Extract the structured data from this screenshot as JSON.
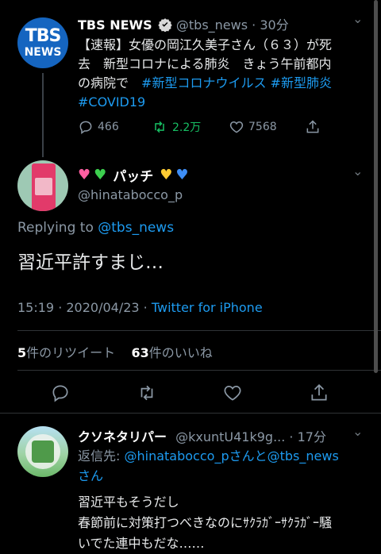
{
  "tweet1": {
    "name": "TBS NEWS",
    "handle": "@tbs_news",
    "time": "30分",
    "text_line1": "【速報】女優の岡江久美子さん（６３）が死",
    "text_line2": "去　新型コロナによる肺炎　きょう午前都内",
    "text_line3": "の病院で",
    "hashtag1": "#新型コロナウイルス",
    "hashtag2": "#新型肺炎",
    "hashtag3": "#COVID19",
    "replies": "466",
    "retweets": "2.2万",
    "likes": "7568",
    "avatar_text1": "TBS",
    "avatar_text2": "NEWS"
  },
  "tweet2": {
    "name": "パッチ",
    "handle": "@hinatabocco_p",
    "replying_prefix": "Replying to",
    "replying_to": "@tbs_news",
    "text": "習近平許すまじ…",
    "timestamp": "15:19 · 2020/04/23 ·",
    "source": "Twitter for iPhone",
    "retweet_count": "5",
    "retweet_label": "件のリツイート",
    "like_count": "63",
    "like_label": "件のいいね"
  },
  "tweet3": {
    "name": "クソネタリパー",
    "handle": "@kxuntU41k9g...",
    "time": "17分",
    "reply_prefix": "返信先:",
    "reply_user1": "@hinatabocco_p",
    "reply_mid": "さんと",
    "reply_user2": "@tbs_news",
    "reply_suffix": "さん",
    "text_line1": "習近平もそうだし",
    "text_line2": "春節前に対策打つべきなのにｻｸﾗｶﾞｰｻｸﾗｶﾞｰ騒",
    "text_line3": "いでた連中もだな……"
  }
}
